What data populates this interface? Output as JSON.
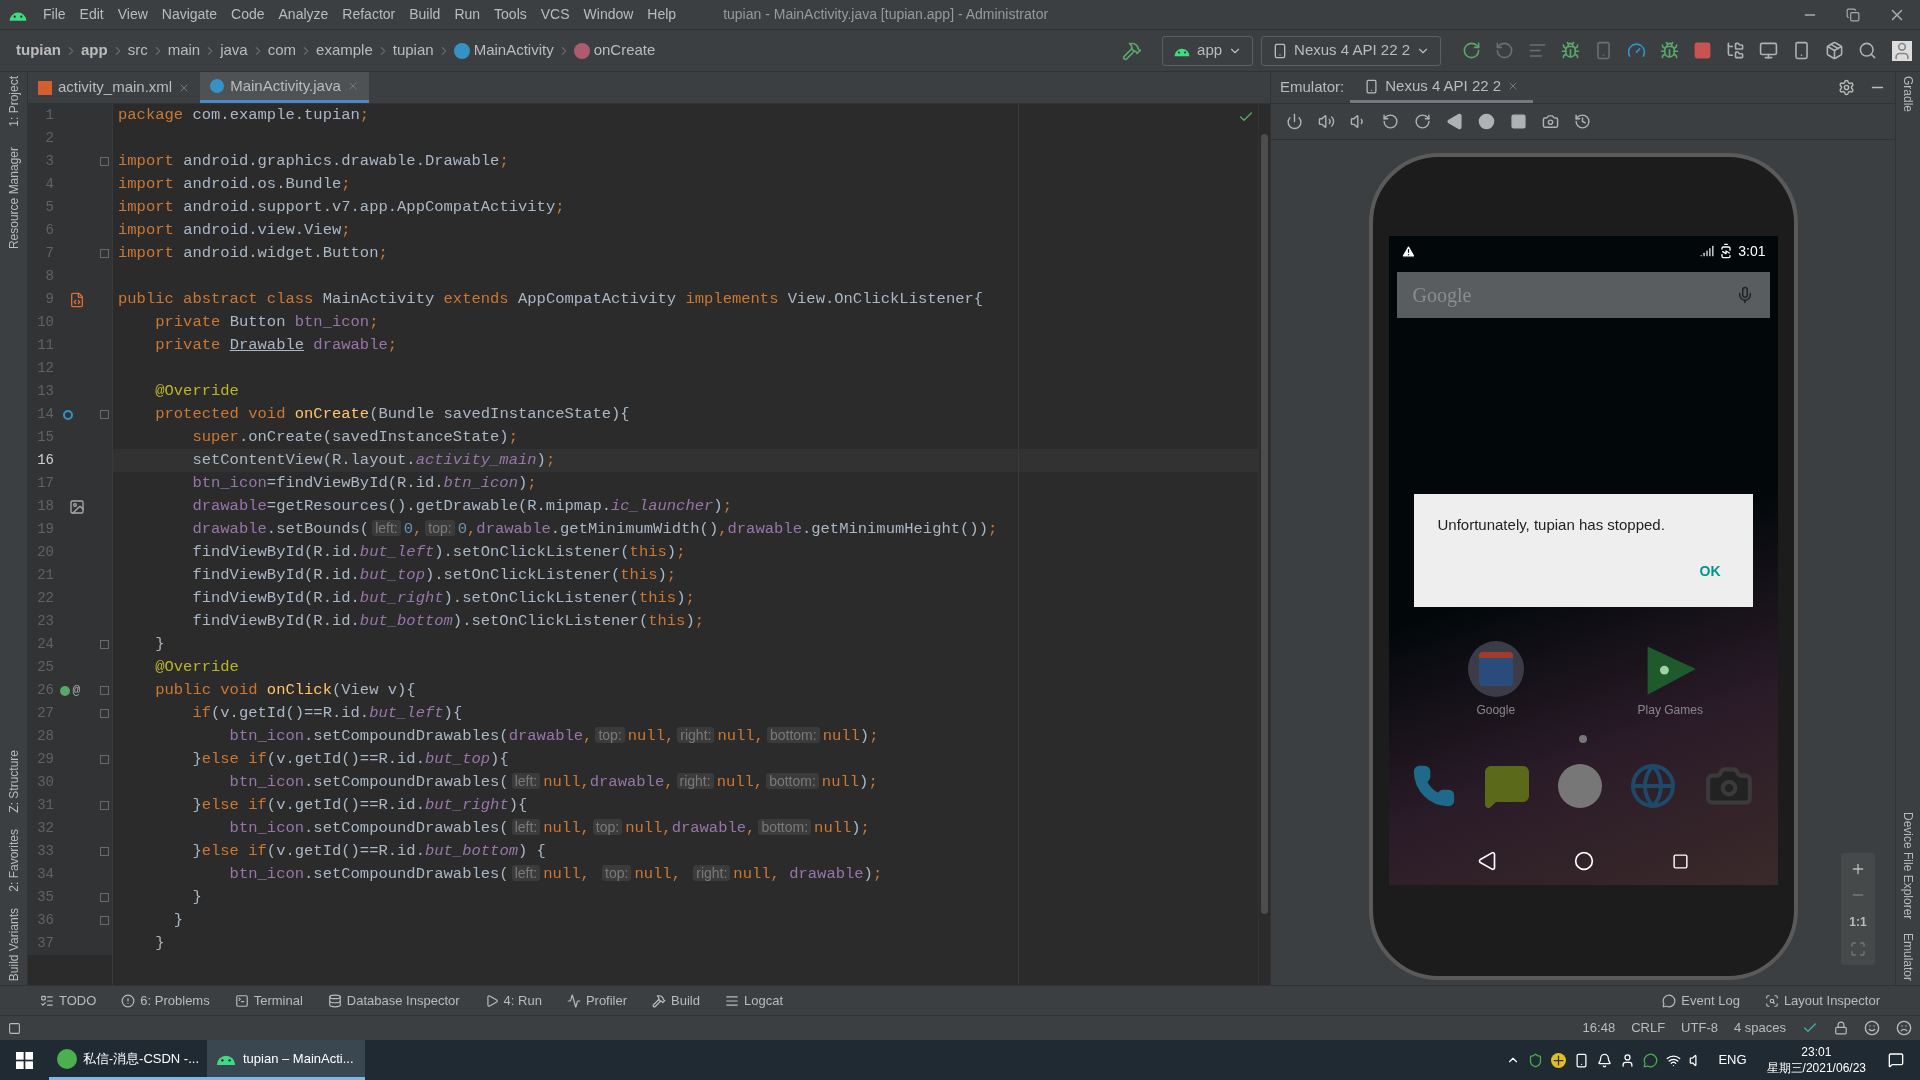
{
  "title_bar": {
    "menus": [
      "File",
      "Edit",
      "View",
      "Navigate",
      "Code",
      "Analyze",
      "Refactor",
      "Build",
      "Run",
      "Tools",
      "VCS",
      "Window",
      "Help"
    ],
    "title": "tupian - MainActivity.java [tupian.app] - Administrator"
  },
  "breadcrumbs": [
    {
      "label": "tupian",
      "kind": "module"
    },
    {
      "label": "app",
      "kind": "module"
    },
    {
      "label": "src",
      "kind": "folder"
    },
    {
      "label": "main",
      "kind": "folder"
    },
    {
      "label": "java",
      "kind": "folder"
    },
    {
      "label": "com",
      "kind": "folder"
    },
    {
      "label": "example",
      "kind": "folder"
    },
    {
      "label": "tupian",
      "kind": "folder"
    },
    {
      "label": "MainActivity",
      "kind": "class"
    },
    {
      "label": "onCreate",
      "kind": "method"
    }
  ],
  "toolbar": {
    "run_config": "app",
    "device": "Nexus 4 API 22 2"
  },
  "left_tool_windows": {
    "top": [
      "1: Project",
      "Resource Manager"
    ],
    "bottom": [
      "Z: Structure",
      "2: Favorites",
      "Build Variants"
    ]
  },
  "editor_tabs": [
    {
      "label": "activity_main.xml",
      "kind": "xml",
      "selected": false
    },
    {
      "label": "MainActivity.java",
      "kind": "class",
      "selected": true
    }
  ],
  "code_lines": [
    {
      "number": "1",
      "fold": false,
      "current": false,
      "tokens": [
        {
          "kind": "kw",
          "text": "package "
        },
        {
          "kind": "plain",
          "text": "com.example.tupian"
        },
        {
          "kind": "kw",
          "text": ";"
        }
      ]
    },
    {
      "number": "2",
      "fold": false,
      "current": false
    },
    {
      "number": "3",
      "fold": true,
      "current": false,
      "tokens": [
        {
          "kind": "kw",
          "text": "import "
        },
        {
          "kind": "plain",
          "text": "android.graphics.drawable.Drawable"
        },
        {
          "kind": "kw",
          "text": ";"
        }
      ]
    },
    {
      "number": "4",
      "fold": false,
      "current": false,
      "tokens": [
        {
          "kind": "kw",
          "text": "import "
        },
        {
          "kind": "plain",
          "text": "android.os.Bundle"
        },
        {
          "kind": "kw",
          "text": ";"
        }
      ]
    },
    {
      "number": "5",
      "fold": false,
      "current": false,
      "tokens": [
        {
          "kind": "kw",
          "text": "import "
        },
        {
          "kind": "plain",
          "text": "android.support.v7.app.AppCompatActivity"
        },
        {
          "kind": "kw",
          "text": ";"
        }
      ]
    },
    {
      "number": "6",
      "fold": false,
      "current": false,
      "tokens": [
        {
          "kind": "kw",
          "text": "import "
        },
        {
          "kind": "plain",
          "text": "android.view.View"
        },
        {
          "kind": "kw",
          "text": ";"
        }
      ]
    },
    {
      "number": "7",
      "fold": true,
      "current": false,
      "tokens": [
        {
          "kind": "kw",
          "text": "import "
        },
        {
          "kind": "plain",
          "text": "android.widget.Button"
        },
        {
          "kind": "kw",
          "text": ";"
        }
      ]
    },
    {
      "number": "8",
      "fold": false,
      "current": false
    },
    {
      "number": "9",
      "fold": false,
      "current": false,
      "gutter": {
        "kind": "layout"
      },
      "tokens": [
        {
          "kind": "kw",
          "text": "public abstract class "
        },
        {
          "kind": "plain",
          "text": "MainActivity "
        },
        {
          "kind": "kw",
          "text": "extends "
        },
        {
          "kind": "plain",
          "text": "AppCompatActivity "
        },
        {
          "kind": "kw",
          "text": "implements "
        },
        {
          "kind": "plain",
          "text": "View.OnClickListener{"
        }
      ]
    },
    {
      "number": "10",
      "fold": false,
      "current": false,
      "tokens": [
        {
          "kind": "kw",
          "text": "    private "
        },
        {
          "kind": "plain",
          "text": "Button "
        },
        {
          "kind": "field",
          "text": "btn_icon"
        },
        {
          "kind": "kw",
          "text": ";"
        }
      ]
    },
    {
      "number": "11",
      "fold": false,
      "current": false,
      "tokens": [
        {
          "kind": "kw",
          "text": "    private "
        },
        {
          "kind": "warn",
          "text": "Drawable"
        },
        {
          "kind": "field",
          "text": " drawable"
        },
        {
          "kind": "kw",
          "text": ";"
        }
      ]
    },
    {
      "number": "12",
      "fold": false,
      "current": false
    },
    {
      "number": "13",
      "fold": false,
      "current": false,
      "tokens": [
        {
          "kind": "ann",
          "text": "    @Override"
        }
      ]
    },
    {
      "number": "14",
      "fold": true,
      "current": false,
      "gutter": {
        "kind": "override"
      },
      "tokens": [
        {
          "kind": "kw",
          "text": "    protected void "
        },
        {
          "kind": "method",
          "text": "onCreate"
        },
        {
          "kind": "plain",
          "text": "(Bundle savedInstanceState){"
        }
      ]
    },
    {
      "number": "15",
      "fold": false,
      "current": false,
      "tokens": [
        {
          "kind": "kw",
          "text": "        super"
        },
        {
          "kind": "plain",
          "text": ".onCreate(savedInstanceState)"
        },
        {
          "kind": "kw",
          "text": ";"
        }
      ]
    },
    {
      "number": "16",
      "fold": false,
      "current": true,
      "tokens": [
        {
          "kind": "plain",
          "text": "        setContentView(R.layout."
        },
        {
          "kind": "static",
          "text": "activity_main"
        },
        {
          "kind": "plain",
          "text": ")"
        },
        {
          "kind": "kw",
          "text": ";"
        }
      ]
    },
    {
      "number": "17",
      "fold": false,
      "current": false,
      "tokens": [
        {
          "kind": "field",
          "text": "        btn_icon"
        },
        {
          "kind": "plain",
          "text": "=findViewById(R.id."
        },
        {
          "kind": "static",
          "text": "btn_icon"
        },
        {
          "kind": "plain",
          "text": ")"
        },
        {
          "kind": "kw",
          "text": ";"
        }
      ]
    },
    {
      "number": "18",
      "fold": false,
      "current": false,
      "gutter": {
        "kind": "image"
      },
      "tokens": [
        {
          "kind": "field",
          "text": "        drawable"
        },
        {
          "kind": "plain",
          "text": "=getResources().getDrawable(R.mipmap."
        },
        {
          "kind": "static",
          "text": "ic_launcher"
        },
        {
          "kind": "plain",
          "text": ")"
        },
        {
          "kind": "kw",
          "text": ";"
        }
      ]
    },
    {
      "number": "19",
      "fold": false,
      "current": false,
      "tokens": [
        {
          "kind": "field",
          "text": "        drawable"
        },
        {
          "kind": "plain",
          "text": ".setBounds("
        },
        {
          "kind": "hint",
          "text": "left:"
        },
        {
          "kind": "num",
          "text": "0"
        },
        {
          "kind": "kw",
          "text": ","
        },
        {
          "kind": "hint",
          "text": "top:"
        },
        {
          "kind": "num",
          "text": "0"
        },
        {
          "kind": "kw",
          "text": ","
        },
        {
          "kind": "field",
          "text": "drawable"
        },
        {
          "kind": "plain",
          "text": ".getMinimumWidth()"
        },
        {
          "kind": "kw",
          "text": ","
        },
        {
          "kind": "field",
          "text": "drawable"
        },
        {
          "kind": "plain",
          "text": ".getMinimumHeight())"
        },
        {
          "kind": "kw",
          "text": ";"
        }
      ]
    },
    {
      "number": "20",
      "fold": false,
      "current": false,
      "tokens": [
        {
          "kind": "plain",
          "text": "        findViewById(R.id."
        },
        {
          "kind": "static",
          "text": "but_left"
        },
        {
          "kind": "plain",
          "text": ").setOnClickListener("
        },
        {
          "kind": "kw",
          "text": "this"
        },
        {
          "kind": "plain",
          "text": ")"
        },
        {
          "kind": "kw",
          "text": ";"
        }
      ]
    },
    {
      "number": "21",
      "fold": false,
      "current": false,
      "tokens": [
        {
          "kind": "plain",
          "text": "        findViewById(R.id."
        },
        {
          "kind": "static",
          "text": "but_top"
        },
        {
          "kind": "plain",
          "text": ").setOnClickListener("
        },
        {
          "kind": "kw",
          "text": "this"
        },
        {
          "kind": "plain",
          "text": ")"
        },
        {
          "kind": "kw",
          "text": ";"
        }
      ]
    },
    {
      "number": "22",
      "fold": false,
      "current": false,
      "tokens": [
        {
          "kind": "plain",
          "text": "        findViewById(R.id."
        },
        {
          "kind": "static",
          "text": "but_right"
        },
        {
          "kind": "plain",
          "text": ").setOnClickListener("
        },
        {
          "kind": "kw",
          "text": "this"
        },
        {
          "kind": "plain",
          "text": ")"
        },
        {
          "kind": "kw",
          "text": ";"
        }
      ]
    },
    {
      "number": "23",
      "fold": false,
      "current": false,
      "tokens": [
        {
          "kind": "plain",
          "text": "        findViewById(R.id."
        },
        {
          "kind": "static",
          "text": "but_bottom"
        },
        {
          "kind": "plain",
          "text": ").setOnClickListener("
        },
        {
          "kind": "kw",
          "text": "this"
        },
        {
          "kind": "plain",
          "text": ")"
        },
        {
          "kind": "kw",
          "text": ";"
        }
      ]
    },
    {
      "number": "24",
      "fold": true,
      "current": false,
      "tokens": [
        {
          "kind": "plain",
          "text": "    }"
        }
      ]
    },
    {
      "number": "25",
      "fold": false,
      "current": false,
      "tokens": [
        {
          "kind": "ann",
          "text": "    @Override"
        }
      ]
    },
    {
      "number": "26",
      "fold": true,
      "current": false,
      "gutter": {
        "kind": "implements",
        "label": "@"
      },
      "tokens": [
        {
          "kind": "kw",
          "text": "    public void "
        },
        {
          "kind": "method",
          "text": "onClick"
        },
        {
          "kind": "plain",
          "text": "(View v){"
        }
      ]
    },
    {
      "number": "27",
      "fold": true,
      "current": false,
      "tokens": [
        {
          "kind": "kw",
          "text": "        if"
        },
        {
          "kind": "plain",
          "text": "(v.getId()==R.id."
        },
        {
          "kind": "static",
          "text": "but_left"
        },
        {
          "kind": "plain",
          "text": "){"
        }
      ]
    },
    {
      "number": "28",
      "fold": false,
      "current": false,
      "tokens": [
        {
          "kind": "field",
          "text": "            btn_icon"
        },
        {
          "kind": "plain",
          "text": ".setCompoundDrawables("
        },
        {
          "kind": "field",
          "text": "drawable"
        },
        {
          "kind": "kw",
          "text": ","
        },
        {
          "kind": "hint",
          "text": "top:"
        },
        {
          "kind": "kw",
          "text": "null,"
        },
        {
          "kind": "hint",
          "text": "right:"
        },
        {
          "kind": "kw",
          "text": "null,"
        },
        {
          "kind": "hint",
          "text": "bottom:"
        },
        {
          "kind": "kw",
          "text": "null"
        },
        {
          "kind": "plain",
          "text": ")"
        },
        {
          "kind": "kw",
          "text": ";"
        }
      ]
    },
    {
      "number": "29",
      "fold": true,
      "current": false,
      "tokens": [
        {
          "kind": "plain",
          "text": "        }"
        },
        {
          "kind": "kw",
          "text": "else if"
        },
        {
          "kind": "plain",
          "text": "(v.getId()==R.id."
        },
        {
          "kind": "static",
          "text": "but_top"
        },
        {
          "kind": "plain",
          "text": "){"
        }
      ]
    },
    {
      "number": "30",
      "fold": false,
      "current": false,
      "tokens": [
        {
          "kind": "field",
          "text": "            btn_icon"
        },
        {
          "kind": "plain",
          "text": ".setCompoundDrawables("
        },
        {
          "kind": "hint",
          "text": "left:"
        },
        {
          "kind": "kw",
          "text": "null,"
        },
        {
          "kind": "field",
          "text": "drawable"
        },
        {
          "kind": "kw",
          "text": ","
        },
        {
          "kind": "hint",
          "text": "right:"
        },
        {
          "kind": "kw",
          "text": "null,"
        },
        {
          "kind": "hint",
          "text": "bottom:"
        },
        {
          "kind": "kw",
          "text": "null"
        },
        {
          "kind": "plain",
          "text": ")"
        },
        {
          "kind": "kw",
          "text": ";"
        }
      ]
    },
    {
      "number": "31",
      "fold": true,
      "current": false,
      "tokens": [
        {
          "kind": "plain",
          "text": "        }"
        },
        {
          "kind": "kw",
          "text": "else if"
        },
        {
          "kind": "plain",
          "text": "(v.getId()==R.id."
        },
        {
          "kind": "static",
          "text": "but_right"
        },
        {
          "kind": "plain",
          "text": "){"
        }
      ]
    },
    {
      "number": "32",
      "fold": false,
      "current": false,
      "tokens": [
        {
          "kind": "field",
          "text": "            btn_icon"
        },
        {
          "kind": "plain",
          "text": ".setCompoundDrawables("
        },
        {
          "kind": "hint",
          "text": "left:"
        },
        {
          "kind": "kw",
          "text": "null,"
        },
        {
          "kind": "hint",
          "text": "top:"
        },
        {
          "kind": "kw",
          "text": "null,"
        },
        {
          "kind": "field",
          "text": "drawable"
        },
        {
          "kind": "kw",
          "text": ","
        },
        {
          "kind": "hint",
          "text": "bottom:"
        },
        {
          "kind": "kw",
          "text": "null"
        },
        {
          "kind": "plain",
          "text": ")"
        },
        {
          "kind": "kw",
          "text": ";"
        }
      ]
    },
    {
      "number": "33",
      "fold": true,
      "current": false,
      "tokens": [
        {
          "kind": "plain",
          "text": "        }"
        },
        {
          "kind": "kw",
          "text": "else if"
        },
        {
          "kind": "plain",
          "text": "(v.getId()==R.id."
        },
        {
          "kind": "static",
          "text": "but_bottom"
        },
        {
          "kind": "plain",
          "text": ") {"
        }
      ]
    },
    {
      "number": "34",
      "fold": false,
      "current": false,
      "tokens": [
        {
          "kind": "field",
          "text": "            btn_icon"
        },
        {
          "kind": "plain",
          "text": ".setCompoundDrawables("
        },
        {
          "kind": "hint",
          "text": "left:"
        },
        {
          "kind": "kw",
          "text": "null, "
        },
        {
          "kind": "hint",
          "text": "top:"
        },
        {
          "kind": "kw",
          "text": "null, "
        },
        {
          "kind": "hint",
          "text": "right:"
        },
        {
          "kind": "kw",
          "text": "null, "
        },
        {
          "kind": "field",
          "text": "drawable"
        },
        {
          "kind": "plain",
          "text": ")"
        },
        {
          "kind": "kw",
          "text": ";"
        }
      ]
    },
    {
      "number": "35",
      "fold": true,
      "current": false,
      "tokens": [
        {
          "kind": "plain",
          "text": "        }"
        }
      ]
    },
    {
      "number": "36",
      "fold": true,
      "current": false,
      "tokens": [
        {
          "kind": "plain",
          "text": "      }"
        }
      ]
    },
    {
      "number": "37",
      "fold": false,
      "current": false,
      "tokens": [
        {
          "kind": "plain",
          "text": "    }"
        }
      ]
    }
  ],
  "emulator": {
    "label": "Emulator:",
    "tab": "Nexus 4 API 22 2",
    "zoom_actual_size": "1:1",
    "screen": {
      "time": "3:01",
      "search_logo": "Google",
      "dialog_message": "Unfortunately, tupian has stopped.",
      "dialog_button": "OK",
      "apps": [
        {
          "label": "Google",
          "kind": "folder"
        },
        {
          "label": "Play Games",
          "kind": "games"
        }
      ]
    }
  },
  "right_tool_windows": {
    "top": [
      "Gradle"
    ],
    "bottom": [
      "Device File Explorer",
      "Emulator"
    ]
  },
  "bottom_tools": {
    "left": [
      "TODO",
      "6: Problems",
      "Terminal",
      "Database Inspector",
      "4: Run",
      "Profiler",
      "Build",
      "Logcat"
    ],
    "right": [
      "Event Log",
      "Layout Inspector"
    ]
  },
  "status_bar": [
    "16:48",
    "CRLF",
    "UTF-8",
    "4 spaces"
  ],
  "taskbar": {
    "tasks": [
      {
        "label": "私信-消息-CSDN -...",
        "kind": "browser",
        "selected": false
      },
      {
        "label": "tupian – MainActi...",
        "kind": "android",
        "selected": true
      }
    ],
    "language": "ENG",
    "time": "23:01",
    "date": "星期三/2021/06/23"
  }
}
